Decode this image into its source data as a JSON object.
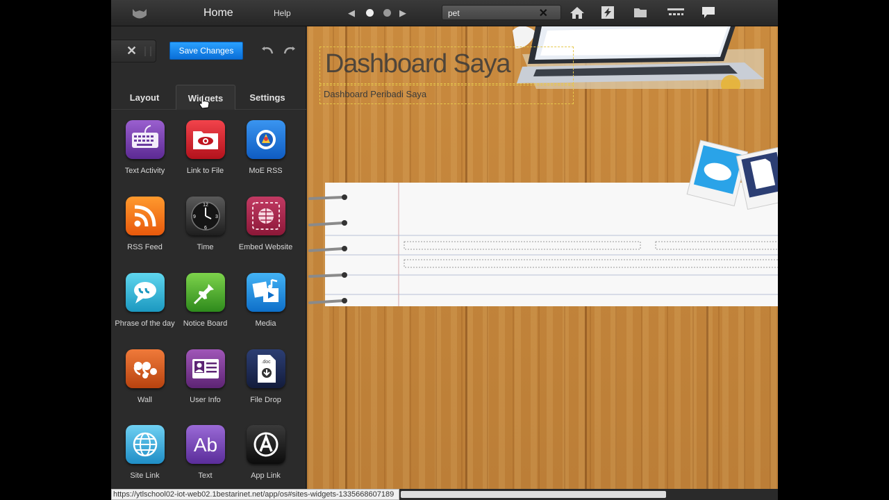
{
  "topbar": {
    "home_label": "Home",
    "help_label": "Help",
    "search": {
      "value": "pet",
      "placeholder": ""
    }
  },
  "panel": {
    "save_label": "Save Changes",
    "tabs": [
      {
        "label": "Layout",
        "active": false
      },
      {
        "label": "Widgets",
        "active": true
      },
      {
        "label": "Settings",
        "active": false
      }
    ],
    "widgets": [
      {
        "label": "Text Activity",
        "icon": "keyboard-icon"
      },
      {
        "label": "Link to File",
        "icon": "eye-folder-icon"
      },
      {
        "label": "MoE RSS",
        "icon": "moe-badge-icon"
      },
      {
        "label": "RSS Feed",
        "icon": "rss-icon"
      },
      {
        "label": "Time",
        "icon": "clock-icon"
      },
      {
        "label": "Embed Website",
        "icon": "globe-frame-icon"
      },
      {
        "label": "Phrase of the day",
        "icon": "speech-bubble-icon"
      },
      {
        "label": "Notice Board",
        "icon": "pushpin-icon"
      },
      {
        "label": "Media",
        "icon": "media-icon"
      },
      {
        "label": "Wall",
        "icon": "quote-icon"
      },
      {
        "label": "User Info",
        "icon": "id-card-icon"
      },
      {
        "label": "File Drop",
        "icon": "doc-download-icon"
      },
      {
        "label": "Site Link",
        "icon": "globe-icon"
      },
      {
        "label": "Text",
        "icon": "ab-text-icon"
      },
      {
        "label": "App Link",
        "icon": "app-a-icon"
      }
    ]
  },
  "canvas": {
    "title": "Dashboard Saya",
    "subtitle": "Dashboard Peribadi Saya"
  },
  "status_url": "https://ytlschool02-iot-web02.1bestarinet.net/app/os#sites-widgets-1335668607189",
  "colors": {
    "accent": "#0a7ee8",
    "panel": "#2b2b2b",
    "wood": "#c98a3e"
  }
}
